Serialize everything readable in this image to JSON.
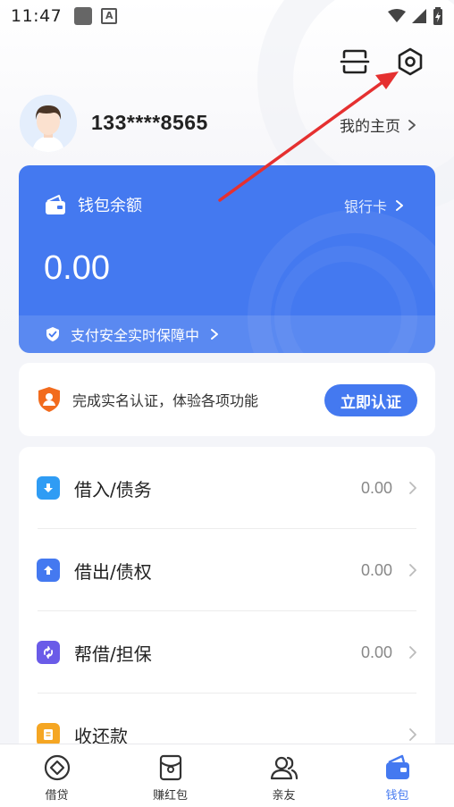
{
  "status_bar": {
    "time": "11:47",
    "a_badge": "A"
  },
  "profile": {
    "phone": "133****8565",
    "homepage_label": "我的主页"
  },
  "wallet": {
    "title": "钱包余额",
    "bankcard_label": "银行卡",
    "balance": "0.00",
    "security_text": "支付安全实时保障中"
  },
  "verify": {
    "text": "完成实名认证，体验各项功能",
    "button_label": "立即认证"
  },
  "list": {
    "items": [
      {
        "label": "借入/债务",
        "value": "0.00",
        "icon": "download-icon",
        "color": "#2f9cf4"
      },
      {
        "label": "借出/债权",
        "value": "0.00",
        "icon": "upload-icon",
        "color": "#4479f0"
      },
      {
        "label": "帮借/担保",
        "value": "0.00",
        "icon": "exchange-icon",
        "color": "#6a5be8"
      },
      {
        "label": "收还款",
        "value": "",
        "icon": "document-icon",
        "color": "#f5a623"
      }
    ]
  },
  "bottom_nav": {
    "items": [
      {
        "label": "借贷",
        "icon": "diamond-icon",
        "active": false
      },
      {
        "label": "赚红包",
        "icon": "red-packet-icon",
        "active": false
      },
      {
        "label": "亲友",
        "icon": "people-icon",
        "active": false
      },
      {
        "label": "钱包",
        "icon": "wallet-icon",
        "active": true
      }
    ]
  },
  "colors": {
    "primary": "#4479f0",
    "verify_badge": "#f26b1d",
    "arrow": "#e53030"
  }
}
